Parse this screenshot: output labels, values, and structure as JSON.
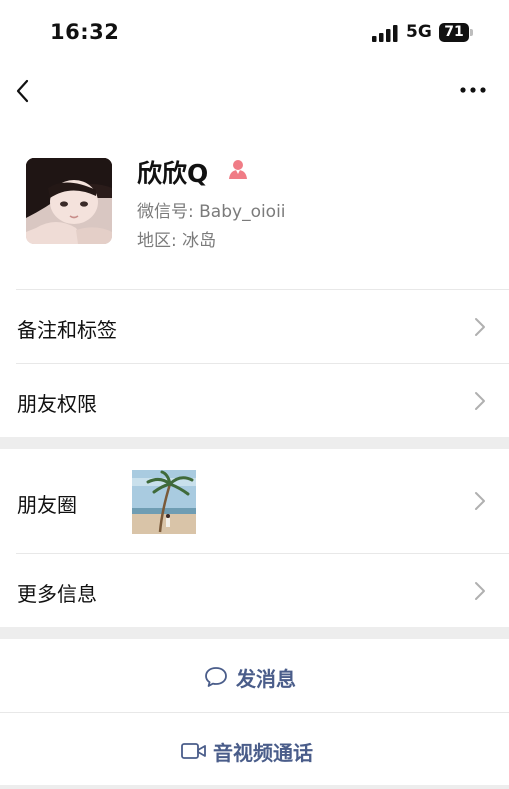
{
  "status_bar": {
    "time": "16:32",
    "network": "5G",
    "battery": "71"
  },
  "navbar": {
    "back_icon": "chevron-left-icon",
    "more_icon": "ellipsis-icon"
  },
  "profile": {
    "nickname": "欣欣Q",
    "wechat_id": "微信号: Baby_oioii",
    "region": "地区: 冰岛",
    "badge_icon": "contact-person-icon"
  },
  "menu": {
    "remark_tags": "备注和标签",
    "friend_permissions": "朋友权限",
    "moments": "朋友圈",
    "more_info": "更多信息"
  },
  "actions": {
    "send_message": "发消息",
    "voice_video_call": "音视频通话"
  },
  "colors": {
    "action_text": "#4a5d8a",
    "badge": "#f07c86",
    "separator": "#ededed"
  }
}
